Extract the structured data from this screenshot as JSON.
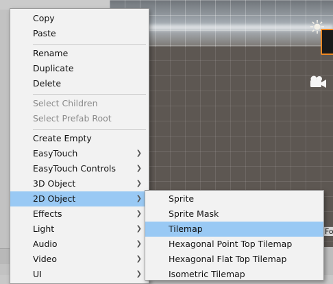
{
  "context_menu": {
    "groups": [
      [
        {
          "label": "Copy"
        },
        {
          "label": "Paste"
        }
      ],
      [
        {
          "label": "Rename"
        },
        {
          "label": "Duplicate"
        },
        {
          "label": "Delete"
        }
      ],
      [
        {
          "label": "Select Children",
          "disabled": true
        },
        {
          "label": "Select Prefab Root",
          "disabled": true
        }
      ],
      [
        {
          "label": "Create Empty"
        },
        {
          "label": "EasyTouch",
          "submenu": true
        },
        {
          "label": "EasyTouch Controls",
          "submenu": true
        },
        {
          "label": "3D Object",
          "submenu": true
        },
        {
          "label": "2D Object",
          "submenu": true,
          "highlighted": true
        },
        {
          "label": "Effects",
          "submenu": true
        },
        {
          "label": "Light",
          "submenu": true
        },
        {
          "label": "Audio",
          "submenu": true
        },
        {
          "label": "Video",
          "submenu": true
        },
        {
          "label": "UI",
          "submenu": true
        }
      ]
    ]
  },
  "submenu_2d_object": {
    "items": [
      {
        "label": "Sprite"
      },
      {
        "label": "Sprite Mask"
      },
      {
        "label": "Tilemap",
        "highlighted": true
      },
      {
        "label": "Hexagonal Point Top Tilemap"
      },
      {
        "label": "Hexagonal Flat Top Tilemap"
      },
      {
        "label": "Isometric Tilemap"
      }
    ]
  },
  "scene_view": {
    "side_label": "Foo",
    "icons": [
      "sun-icon",
      "camera-icon"
    ],
    "selection_color": "#f08a24"
  },
  "colors": {
    "menu_background": "#f2f2f2",
    "highlight": "#99c9f4",
    "disabled_text": "#8a8a8a"
  }
}
